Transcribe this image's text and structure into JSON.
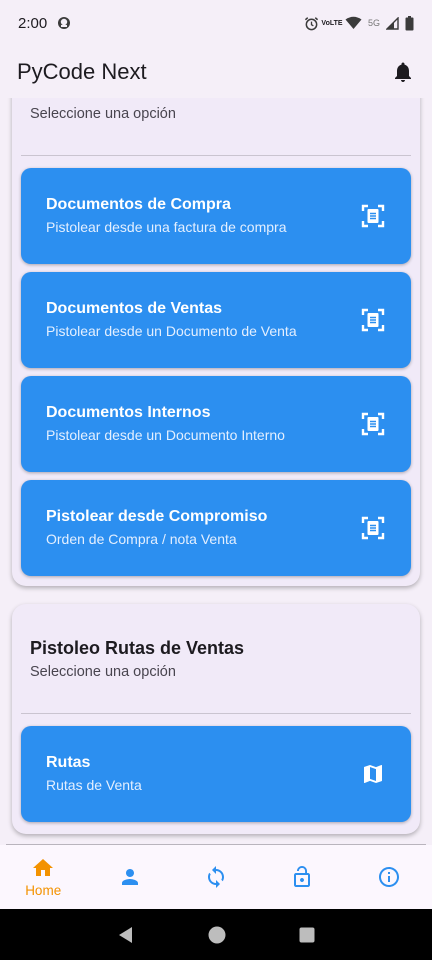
{
  "status_bar": {
    "time": "2:00",
    "lte_top": "Vo",
    "lte_bottom": "LTE",
    "network": "5G"
  },
  "app_bar": {
    "title": "PyCode Next",
    "notification_icon": "bell-icon"
  },
  "section_compras": {
    "subtitle": "Seleccione una opción",
    "tiles": [
      {
        "title": "Documentos de Compra",
        "subtitle": "Pistolear desde una factura de compra",
        "icon": "document-scan-icon"
      },
      {
        "title": "Documentos de Ventas",
        "subtitle": "Pistolear desde un Documento de Venta",
        "icon": "document-scan-icon"
      },
      {
        "title": "Documentos Internos",
        "subtitle": "Pistolear desde un Documento Interno",
        "icon": "document-scan-icon"
      },
      {
        "title": "Pistolear desde Compromiso",
        "subtitle": "Orden de Compra / nota Venta",
        "icon": "document-scan-icon"
      }
    ]
  },
  "section_rutas": {
    "title": "Pistoleo Rutas de Ventas",
    "subtitle": "Seleccione una opción",
    "tiles": [
      {
        "title": "Rutas",
        "subtitle": "Rutas de Venta",
        "icon": "map-icon"
      }
    ]
  },
  "bottom_nav": {
    "items": [
      {
        "label": "Home",
        "icon": "home-icon",
        "active": true
      },
      {
        "label": "",
        "icon": "person-icon",
        "active": false
      },
      {
        "label": "",
        "icon": "sync-icon",
        "active": false
      },
      {
        "label": "",
        "icon": "lock-open-icon",
        "active": false
      },
      {
        "label": "",
        "icon": "info-icon",
        "active": false
      }
    ]
  },
  "colors": {
    "background": "#f5eff8",
    "card": "#f1eaf8",
    "tile": "#2c8ff0",
    "nav_active": "#f39200",
    "nav_inactive": "#2c8ff0"
  }
}
